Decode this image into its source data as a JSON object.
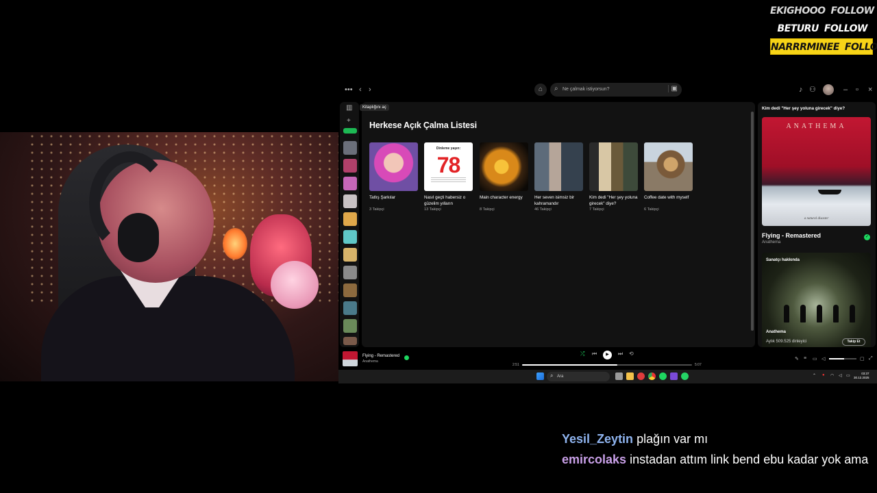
{
  "alerts": [
    {
      "name": "EKIGHOOO",
      "action": "FOLLOW"
    },
    {
      "name": "BETURU",
      "action": "FOLLOW"
    },
    {
      "name": "NARRRMINEE",
      "action": "FOLLOW"
    }
  ],
  "spotify": {
    "search_placeholder": "Ne çalmak istiyorsun?",
    "tooltip": "Kitaplığını aç",
    "section_title": "Herkese Açık Çalma Listesi",
    "playlists": [
      {
        "title": "Tatlış Şarkılar",
        "followers": "3 Takipçi"
      },
      {
        "title": "Nasıl geçti habersiz o güzelim yılların",
        "followers": "13 Takipçi",
        "cover_top": "Dinleme yaşın:",
        "cover_number": "78"
      },
      {
        "title": "Main character energy",
        "followers": "8 Takipçi"
      },
      {
        "title": "Her seven isimsiz bir kahramandır",
        "followers": "46 Takipçi"
      },
      {
        "title": "Kim dedi \"Her şey yoluna girecek\" diye?",
        "followers": "7 Takipçi"
      },
      {
        "title": "Coffee date with myself",
        "followers": "6 Takipçi"
      }
    ],
    "now_playing_panel": {
      "playlist_name": "Kim dedi \"Her şey yoluna girecek\" diye?",
      "album_banner": "ANATHEMA",
      "album_script": "a natural disaster",
      "track": "Flying - Remastered",
      "artist": "Anathema",
      "about_label": "Sanatçı hakkında",
      "about_artist": "Anathema",
      "monthly_listeners": "Aylık 509.525 dinleyici",
      "follow_button": "Takip Et"
    },
    "player": {
      "track": "Flying - Remastered",
      "artist": "Anathema",
      "elapsed": "2:51",
      "duration": "5:07",
      "progress_fraction": 0.56,
      "volume_fraction": 0.55
    }
  },
  "taskbar": {
    "search_placeholder": "Ara",
    "time": "03:37",
    "date": "30.12.2025"
  },
  "chat": [
    {
      "user": "Yesil_Zeytin",
      "text": "plağın var mı"
    },
    {
      "user": "emircolaks",
      "text": "instadan attım link bend ebu kadar yok ama"
    }
  ],
  "colors": {
    "spotify_green": "#1ed760",
    "alert_highlight": "#f7d417",
    "panel": "#121212"
  }
}
